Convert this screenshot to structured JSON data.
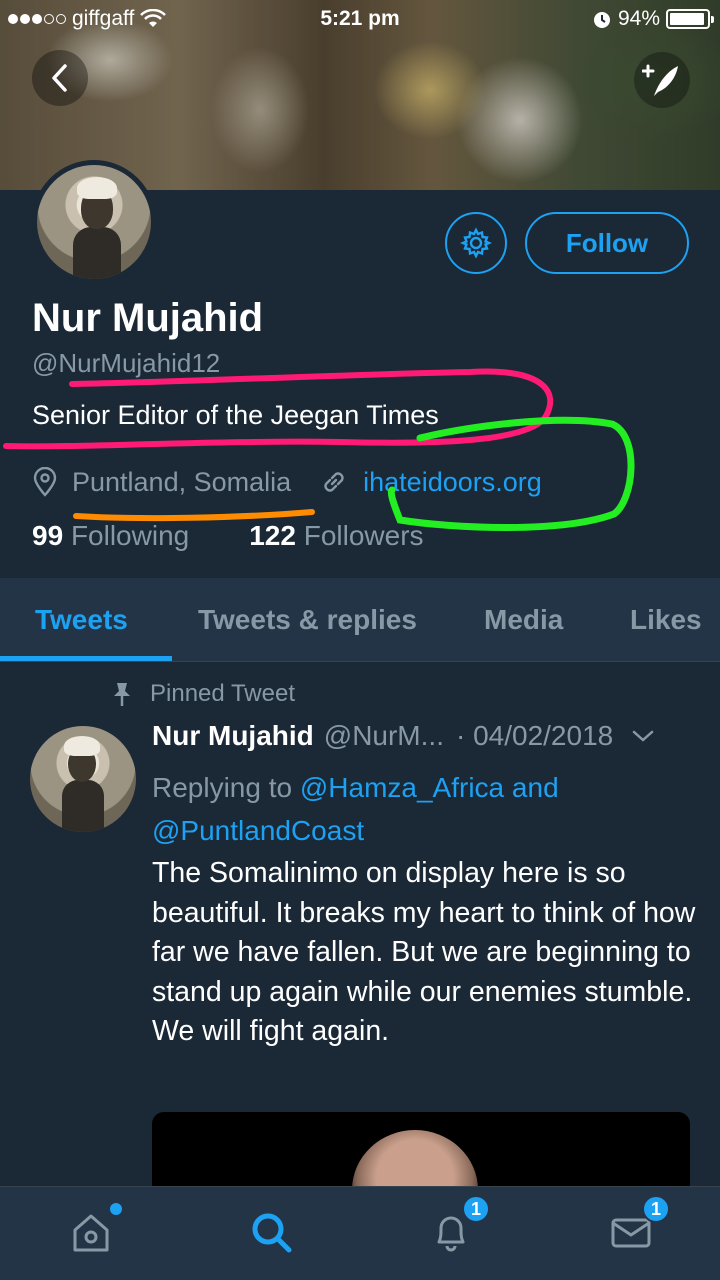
{
  "status_bar": {
    "carrier": "giffgaff",
    "time": "5:21 pm",
    "battery_percent": "94%",
    "battery_level": 0.94
  },
  "profile": {
    "name": "Nur Mujahid",
    "handle": "@NurMujahid12",
    "bio": "Senior Editor of the Jeegan Times",
    "location": "Puntland, Somalia",
    "website": "ihateidoors.org",
    "following_count": "99",
    "following_label": "Following",
    "followers_count": "122",
    "followers_label": "Followers",
    "follow_button": "Follow"
  },
  "tabs": [
    {
      "label": "Tweets",
      "active": true
    },
    {
      "label": "Tweets & replies",
      "active": false
    },
    {
      "label": "Media",
      "active": false
    },
    {
      "label": "Likes",
      "active": false
    }
  ],
  "tweet": {
    "pinned_label": "Pinned Tweet",
    "author_name": "Nur Mujahid",
    "author_handle": "@NurM...",
    "date": "· 04/02/2018",
    "replying_prefix": "Replying to",
    "reply_mention_1": "@Hamza_Africa",
    "reply_joiner": "and",
    "reply_mention_2": "@PuntlandCoast",
    "text": "The Somalinimo on display here is so beautiful. It breaks my heart to think of how far we have fallen. But we are beginning to stand up again while our enemies stumble. We will fight again."
  },
  "bottom_nav": {
    "notifications_badge": "1",
    "messages_badge": "1"
  },
  "colors": {
    "background": "#1b2836",
    "accent": "#1da1f2",
    "secondary_text": "#8899a6",
    "annotation_pink": "#ff1a75",
    "annotation_green": "#22ee22",
    "annotation_orange": "#ff8c00"
  }
}
